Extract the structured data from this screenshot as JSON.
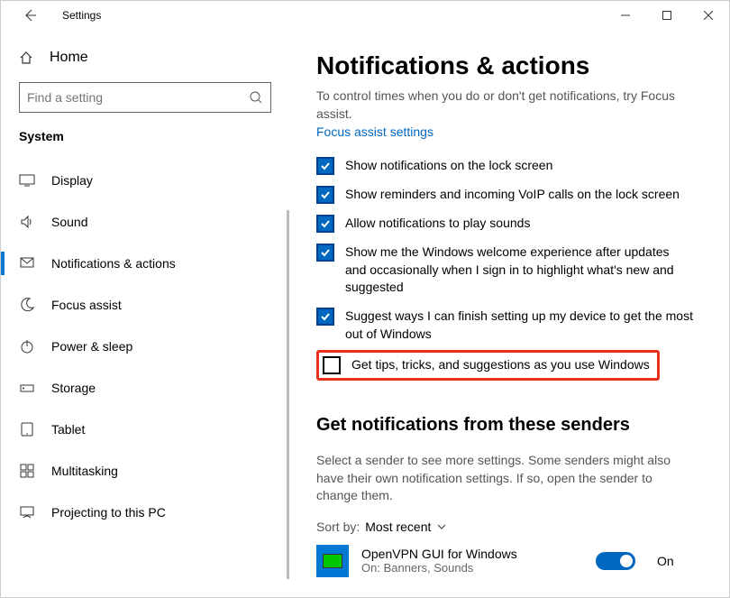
{
  "window": {
    "title": "Settings"
  },
  "sidebar": {
    "home": "Home",
    "search_placeholder": "Find a setting",
    "section": "System",
    "items": [
      {
        "label": "Display",
        "icon": "display"
      },
      {
        "label": "Sound",
        "icon": "sound"
      },
      {
        "label": "Notifications & actions",
        "icon": "notifications",
        "selected": true
      },
      {
        "label": "Focus assist",
        "icon": "moon"
      },
      {
        "label": "Power & sleep",
        "icon": "power"
      },
      {
        "label": "Storage",
        "icon": "storage"
      },
      {
        "label": "Tablet",
        "icon": "tablet"
      },
      {
        "label": "Multitasking",
        "icon": "multitasking"
      },
      {
        "label": "Projecting to this PC",
        "icon": "projecting"
      }
    ]
  },
  "main": {
    "heading": "Notifications & actions",
    "desc": "To control times when you do or don't get notifications, try Focus assist.",
    "link": "Focus assist settings",
    "checkboxes": [
      {
        "label": "Show notifications on the lock screen",
        "checked": true
      },
      {
        "label": "Show reminders and incoming VoIP calls on the lock screen",
        "checked": true
      },
      {
        "label": "Allow notifications to play sounds",
        "checked": true
      },
      {
        "label": "Show me the Windows welcome experience after updates and occasionally when I sign in to highlight what's new and suggested",
        "checked": true
      },
      {
        "label": "Suggest ways I can finish setting up my device to get the most out of Windows",
        "checked": true
      },
      {
        "label": "Get tips, tricks, and suggestions as you use Windows",
        "checked": false,
        "highlighted": true
      }
    ],
    "senders_heading": "Get notifications from these senders",
    "senders_desc": "Select a sender to see more settings. Some senders might also have their own notification settings. If so, open the sender to change them.",
    "sort_label": "Sort by:",
    "sort_value": "Most recent",
    "sender": {
      "name": "OpenVPN GUI for Windows",
      "sub": "On: Banners, Sounds",
      "toggle_on": true,
      "toggle_label": "On"
    }
  }
}
